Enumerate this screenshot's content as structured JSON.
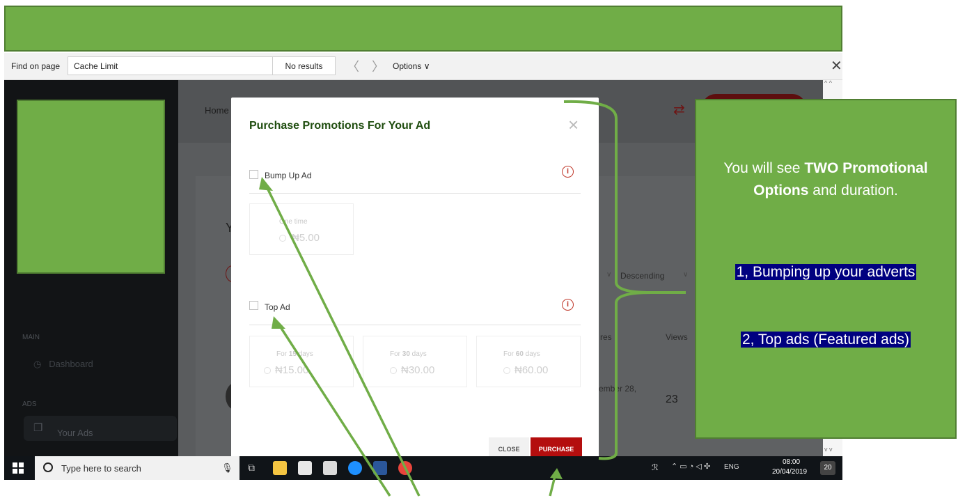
{
  "find_bar": {
    "label": "Find on page",
    "query": "Cache Limit",
    "results": "No results",
    "prev": "〈",
    "next": "〉",
    "options": "Options ∨",
    "close": "✕"
  },
  "background_app": {
    "nav_home": "Home",
    "sidebar_main": "MAIN",
    "sidebar_dashboard": "Dashboard",
    "sidebar_ads": "ADS",
    "sidebar_your_ads": "Your Ads",
    "y_char": "Y",
    "sort_order": "Descending",
    "col_res": "res",
    "col_views": "Views",
    "row_date": "ember 28,",
    "row_views": "23"
  },
  "modal": {
    "title": "Purchase Promotions For Your Ad",
    "close_icon": "×",
    "bump": {
      "label": "Bump Up Ad",
      "info_icon": "i",
      "option": {
        "label": "One time",
        "price": "₦5.00"
      }
    },
    "top": {
      "label": "Top Ad",
      "info_icon": "i",
      "options": [
        {
          "label_prefix": "For ",
          "days": "15",
          "label_suffix": " days",
          "price": "₦15.00"
        },
        {
          "label_prefix": "For ",
          "days": "30",
          "label_suffix": " days",
          "price": "₦30.00"
        },
        {
          "label_prefix": "For ",
          "days": "60",
          "label_suffix": " days",
          "price": "₦60.00"
        }
      ]
    },
    "close_button": "CLOSE",
    "purchase_button": "PURCHASE"
  },
  "callout": {
    "text_1": "You will see ",
    "bold_1": "TWO Promotional Options",
    "text_2": " and duration.",
    "item_1": "1, Bumping up your adverts",
    "item_2": "2, Top ads (Featured ads)"
  },
  "taskbar": {
    "search_placeholder": "Type here to search",
    "tray_lang": "ENG",
    "time": "08:00",
    "date": "20/04/2019",
    "notifications": "20"
  },
  "colors": {
    "annotation_green": "#70ad47",
    "purchase_red": "#b40e0e",
    "highlight_blue": "#000080",
    "title_green": "#1f4d0f"
  }
}
